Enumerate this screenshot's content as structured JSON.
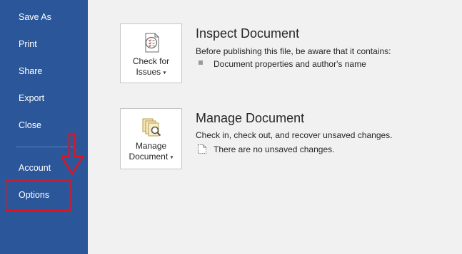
{
  "sidebar": {
    "items": [
      {
        "label": "Save As"
      },
      {
        "label": "Print"
      },
      {
        "label": "Share"
      },
      {
        "label": "Export"
      },
      {
        "label": "Close"
      },
      {
        "label": "Account"
      },
      {
        "label": "Options"
      }
    ]
  },
  "inspect": {
    "button_line1": "Check for",
    "button_line2": "Issues",
    "title": "Inspect Document",
    "description": "Before publishing this file, be aware that it contains:",
    "bullet": "Document properties and author's name",
    "icon": "inspect-document-icon"
  },
  "manage": {
    "button_line1": "Manage",
    "button_line2": "Document",
    "title": "Manage Document",
    "description": "Check in, check out, and recover unsaved changes.",
    "status": "There are no unsaved changes.",
    "icon": "manage-document-icon"
  },
  "colors": {
    "sidebar": "#2b579a",
    "background": "#f1f1f1",
    "annotation": "#e0141e"
  }
}
